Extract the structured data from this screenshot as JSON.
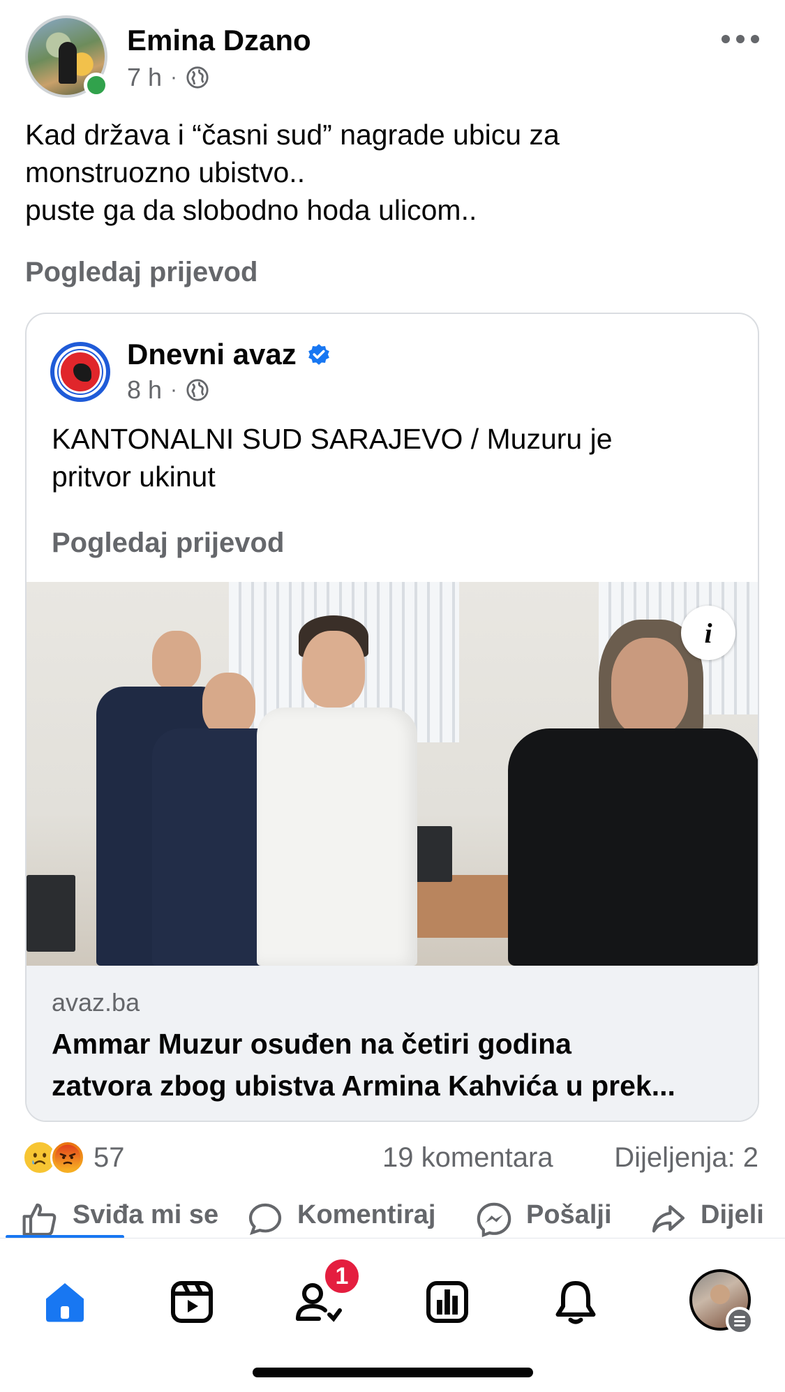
{
  "post": {
    "author": "Emina Dzano",
    "time": "7 h",
    "separator": "·",
    "audience_icon": "globe-icon",
    "text_lines": [
      "Kad država i “časni sud” nagrade ubicu za",
      "monstruozno ubistvo..",
      "puste ga da slobodno hoda ulicom.."
    ],
    "see_translation": "Pogledaj prijevod"
  },
  "shared": {
    "page_name": "Dnevni avaz",
    "verified_icon": "verified-badge-icon",
    "time": "8 h",
    "separator": "·",
    "text_lines": [
      "KANTONALNI SUD SARAJEVO / Muzuru je",
      "pritvor ukinut"
    ],
    "see_translation": "Pogledaj prijevod",
    "info_label": "i",
    "link": {
      "domain": "avaz.ba",
      "title_lines": [
        "Ammar Muzur osuđen na četiri godina",
        "zatvora zbog ubistva Armina Kahvića u prek..."
      ]
    }
  },
  "engagement": {
    "reaction_icons": [
      "sad-reaction-icon",
      "angry-reaction-icon"
    ],
    "reaction_count": "57",
    "comments": "19 komentara",
    "shares": "Dijeljenja: 2"
  },
  "actions": {
    "like": "Sviđa mi se",
    "comment": "Komentiraj",
    "send": "Pošalji",
    "share": "Dijeli"
  },
  "bottom_nav": {
    "items": [
      "home-icon",
      "video-icon",
      "friends-icon",
      "dashboard-icon",
      "notifications-icon",
      "profile-avatar"
    ],
    "friends_badge": "1"
  },
  "colors": {
    "accent": "#1877f2",
    "secondary_text": "#65676b",
    "badge": "#e41e3f",
    "online": "#31a24c"
  }
}
